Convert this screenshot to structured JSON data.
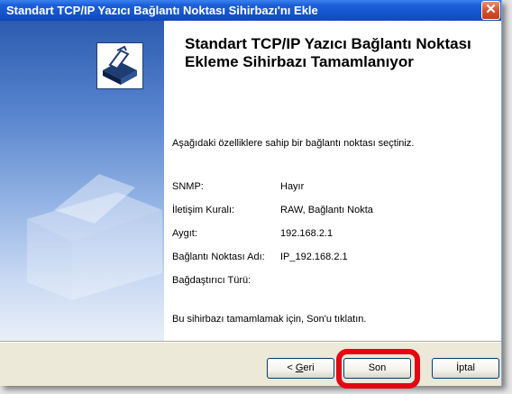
{
  "window": {
    "title": "Standart TCP/IP Yazıcı Bağlantı Noktası Sihirbazı'nı Ekle",
    "close_glyph": "✕"
  },
  "content": {
    "heading": "Standart TCP/IP Yazıcı Bağlantı Noktası Ekleme Sihirbazı Tamamlanıyor",
    "intro": "Aşağıdaki özelliklere sahip bir bağlantı noktası seçtiniz.",
    "properties": [
      {
        "label": "SNMP:",
        "value": "Hayır"
      },
      {
        "label": "İletişim Kuralı:",
        "value": "RAW, Bağlantı Nokta"
      },
      {
        "label": "Aygıt:",
        "value": "192.168.2.1"
      },
      {
        "label": "Bağlantı Noktası Adı:",
        "value": "IP_192.168.2.1"
      },
      {
        "label": "Bağdaştırıcı Türü:",
        "value": ""
      }
    ],
    "finish_text": "Bu sihirbazı tamamlamak için, Son'u tıklatın."
  },
  "buttons": {
    "back_prefix": "< ",
    "back_accel": "G",
    "back_rest": "eri",
    "finish": "Son",
    "cancel": "İptal"
  },
  "colors": {
    "titlebar": "#1556cf",
    "highlight": "#e30613",
    "sidebar_top": "#2c5bb0"
  },
  "icons": [
    "close-icon",
    "wizard-icon",
    "printer-icon"
  ]
}
